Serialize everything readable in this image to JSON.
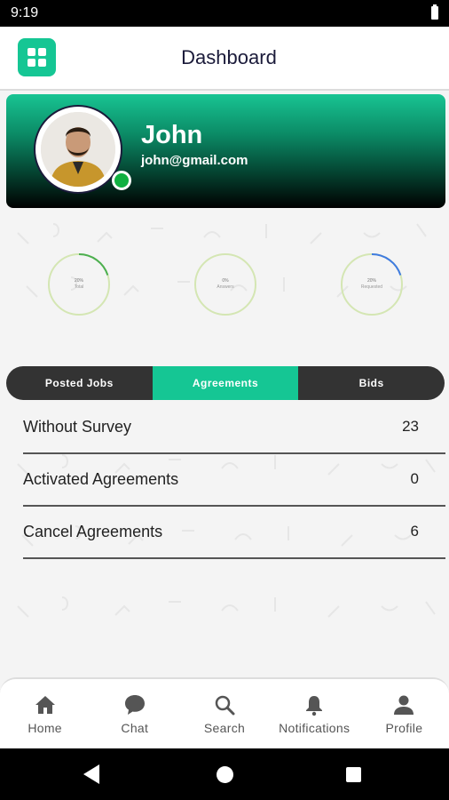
{
  "status_bar": {
    "time": "9:19"
  },
  "app_bar": {
    "title": "Dashboard"
  },
  "profile": {
    "name": "John",
    "email": "john@gmail.com"
  },
  "stats": [
    {
      "value": "20%",
      "label": "Total",
      "progress": 0.2,
      "color": "#4caf50"
    },
    {
      "value": "0%",
      "label": "Answers",
      "progress": 0.0,
      "color": "#4caf50"
    },
    {
      "value": "20%",
      "label": "Requested",
      "progress": 0.2,
      "color": "#3f7be0"
    }
  ],
  "tabs": [
    {
      "label": "Posted Jobs",
      "active": false
    },
    {
      "label": "Agreements",
      "active": true
    },
    {
      "label": "Bids",
      "active": false
    }
  ],
  "rows": [
    {
      "label": "Without Survey",
      "value": "23"
    },
    {
      "label": "Activated Agreements",
      "value": "0"
    },
    {
      "label": "Cancel Agreements",
      "value": "6"
    }
  ],
  "bottom_nav": [
    {
      "label": "Home",
      "icon": "home-icon"
    },
    {
      "label": "Chat",
      "icon": "chat-icon"
    },
    {
      "label": "Search",
      "icon": "search-icon"
    },
    {
      "label": "Notifications",
      "icon": "bell-icon"
    },
    {
      "label": "Profile",
      "icon": "person-icon"
    }
  ],
  "colors": {
    "accent": "#15c694",
    "tab_bar": "#333333"
  }
}
